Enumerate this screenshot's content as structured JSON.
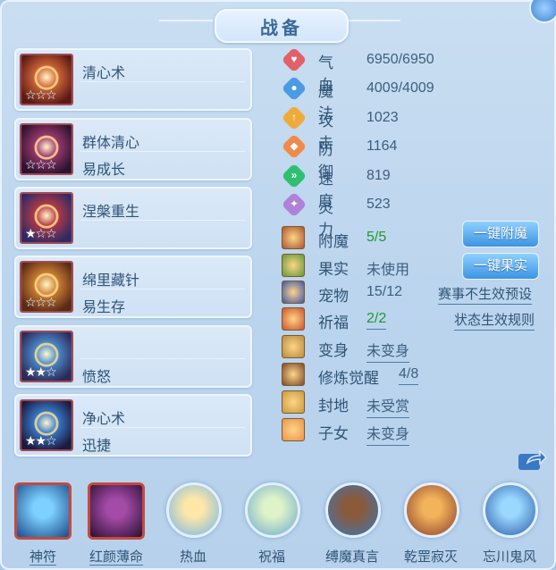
{
  "title": "战备",
  "skills": [
    {
      "name": "清心术",
      "sub": "",
      "stars": "☆☆☆",
      "filled": 0,
      "bg1": "#d66a3b",
      "bg2": "#5a1a13"
    },
    {
      "name": "群体清心",
      "sub": "易成长",
      "stars": "☆☆☆",
      "filled": 0,
      "bg1": "#9f3a70",
      "bg2": "#2c1330"
    },
    {
      "name": "涅槃重生",
      "sub": "",
      "stars": "★☆☆",
      "filled": 1,
      "bg1": "#b93a44",
      "bg2": "#2e2a66"
    },
    {
      "name": "绵里藏针",
      "sub": "易生存",
      "stars": "☆☆☆",
      "filled": 0,
      "bg1": "#d28436",
      "bg2": "#5a2a15"
    },
    {
      "name": "",
      "sub": "愤怒",
      "stars": "★★☆",
      "filled": 2,
      "bg1": "#4d8fd0",
      "bg2": "#2b2b5a"
    },
    {
      "name": "净心术",
      "sub": "迅捷",
      "stars": "★★☆",
      "filled": 2,
      "bg1": "#3b7fd0",
      "bg2": "#1b1b40"
    }
  ],
  "attributes": [
    {
      "label": "气血",
      "value": "6950/6950",
      "icon": "heart-icon",
      "color": "#e2606a",
      "glyph": "♥"
    },
    {
      "label": "魔法",
      "value": "4009/4009",
      "icon": "mana-icon",
      "color": "#4b9be3",
      "glyph": "●"
    },
    {
      "label": "攻击",
      "value": "1023",
      "icon": "attack-icon",
      "color": "#f0aa3b",
      "glyph": "↑"
    },
    {
      "label": "防御",
      "value": "1164",
      "icon": "defense-icon",
      "color": "#ef8a4a",
      "glyph": "◆"
    },
    {
      "label": "速度",
      "value": "819",
      "icon": "speed-icon",
      "color": "#2fbf72",
      "glyph": "»"
    },
    {
      "label": "灵力",
      "value": "523",
      "icon": "spirit-icon",
      "color": "#b081d9",
      "glyph": "✦"
    }
  ],
  "features": [
    {
      "label": "附魔",
      "value": "5/5",
      "green": true,
      "underline": false,
      "color": "#a8552d"
    },
    {
      "label": "果实",
      "value": "未使用",
      "green": false,
      "underline": false,
      "color": "#5f9a37"
    },
    {
      "label": "宠物",
      "value": "15/12",
      "green": false,
      "underline": false,
      "color": "#3d58a8"
    },
    {
      "label": "祈福",
      "value": "2/2",
      "green": true,
      "underline": true,
      "color": "#c9542a"
    },
    {
      "label": "变身",
      "value": "未变身",
      "green": false,
      "underline": true,
      "color": "#b88a3b"
    },
    {
      "label": "修炼觉醒",
      "value": "4/8",
      "green": false,
      "underline": true,
      "color": "#7a4a2a"
    },
    {
      "label": "封地",
      "value": "未受赏",
      "green": false,
      "underline": true,
      "color": "#c89a3a"
    },
    {
      "label": "子女",
      "value": "未变身",
      "green": false,
      "underline": true,
      "color": "#e8944a"
    }
  ],
  "buttons": {
    "enchant": "一键附魔",
    "fruit": "一键果实"
  },
  "links": {
    "event": "赛事不生效预设",
    "state": "状态生效规则"
  },
  "bottom": [
    {
      "label": "神符",
      "shape": "square",
      "c1": "#7dd0ff",
      "c2": "#1a4a8a"
    },
    {
      "label": "红颜薄命",
      "shape": "square",
      "c1": "#a44aa8",
      "c2": "#2a1030"
    },
    {
      "label": "热血",
      "shape": "round",
      "c1": "#ffe7a8",
      "c2": "#6fb6e8"
    },
    {
      "label": "祝福",
      "shape": "round",
      "c1": "#dff3c8",
      "c2": "#6aa9cf"
    },
    {
      "label": "缚魔真言",
      "shape": "round",
      "c1": "#8a5a3a",
      "c2": "#3a78b8"
    },
    {
      "label": "乾罡寂灭",
      "shape": "round",
      "c1": "#f2b45a",
      "c2": "#8a3a2a"
    },
    {
      "label": "忘川鬼风",
      "shape": "round",
      "c1": "#9ad8ff",
      "c2": "#2a5aa8"
    }
  ]
}
